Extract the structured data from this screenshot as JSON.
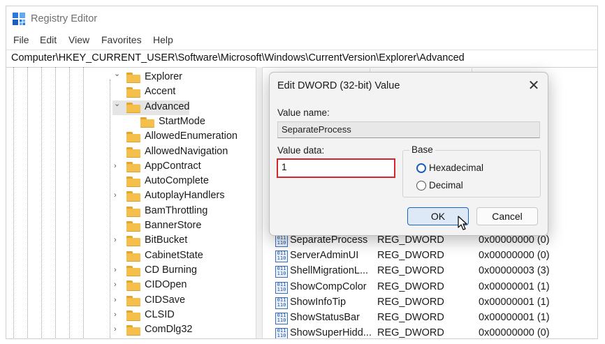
{
  "window": {
    "title": "Registry Editor"
  },
  "menu": [
    "File",
    "Edit",
    "View",
    "Favorites",
    "Help"
  ],
  "address": "Computer\\HKEY_CURRENT_USER\\Software\\Microsoft\\Windows\\CurrentVersion\\Explorer\\Advanced",
  "tree": [
    {
      "label": "Explorer",
      "expanded": true
    },
    {
      "label": "Accent"
    },
    {
      "label": "Advanced",
      "expanded": true,
      "selected": true
    },
    {
      "label": "StartMode"
    },
    {
      "label": "AllowedEnumeration"
    },
    {
      "label": "AllowedNavigation"
    },
    {
      "label": "AppContract",
      "collapsed": true
    },
    {
      "label": "AutoComplete"
    },
    {
      "label": "AutoplayHandlers",
      "collapsed": true
    },
    {
      "label": "BamThrottling"
    },
    {
      "label": "BannerStore"
    },
    {
      "label": "BitBucket",
      "collapsed": true
    },
    {
      "label": "CabinetState"
    },
    {
      "label": "CD Burning",
      "collapsed": true
    },
    {
      "label": "CIDOpen",
      "collapsed": true
    },
    {
      "label": "CIDSave",
      "collapsed": true
    },
    {
      "label": "CLSID",
      "collapsed": true
    },
    {
      "label": "ComDlg32",
      "collapsed": true
    }
  ],
  "values": [
    {
      "name": "SeparateProcess",
      "type": "REG_DWORD",
      "data": "0x00000000 (0)"
    },
    {
      "name": "ServerAdminUI",
      "type": "REG_DWORD",
      "data": "0x00000000 (0)"
    },
    {
      "name": "ShellMigrationL...",
      "type": "REG_DWORD",
      "data": "0x00000003 (3)"
    },
    {
      "name": "ShowCompColor",
      "type": "REG_DWORD",
      "data": "0x00000001 (1)"
    },
    {
      "name": "ShowInfoTip",
      "type": "REG_DWORD",
      "data": "0x00000001 (1)"
    },
    {
      "name": "ShowStatusBar",
      "type": "REG_DWORD",
      "data": "0x00000001 (1)"
    },
    {
      "name": "ShowSuperHidd...",
      "type": "REG_DWORD",
      "data": "0x00000000 (0)"
    }
  ],
  "dialog": {
    "title": "Edit DWORD (32-bit) Value",
    "value_name_label": "Value name:",
    "value_name": "SeparateProcess",
    "value_data_label": "Value data:",
    "value_data": "1",
    "base_label": "Base",
    "base_options": [
      "Hexadecimal",
      "Decimal"
    ],
    "base_selected": "Hexadecimal",
    "ok_label": "OK",
    "cancel_label": "Cancel",
    "close_glyph": "✕"
  },
  "colors": {
    "highlight_border": "#d6252b",
    "folder": "#f4c04b",
    "ok_border": "#1a62c4",
    "radio_selected": "#1d5fb8"
  },
  "icons": {
    "app": "registry-editor-icon",
    "folder": "folder-icon",
    "value": "reg-binary-value-icon",
    "cursor": "mouse-pointer-icon"
  }
}
